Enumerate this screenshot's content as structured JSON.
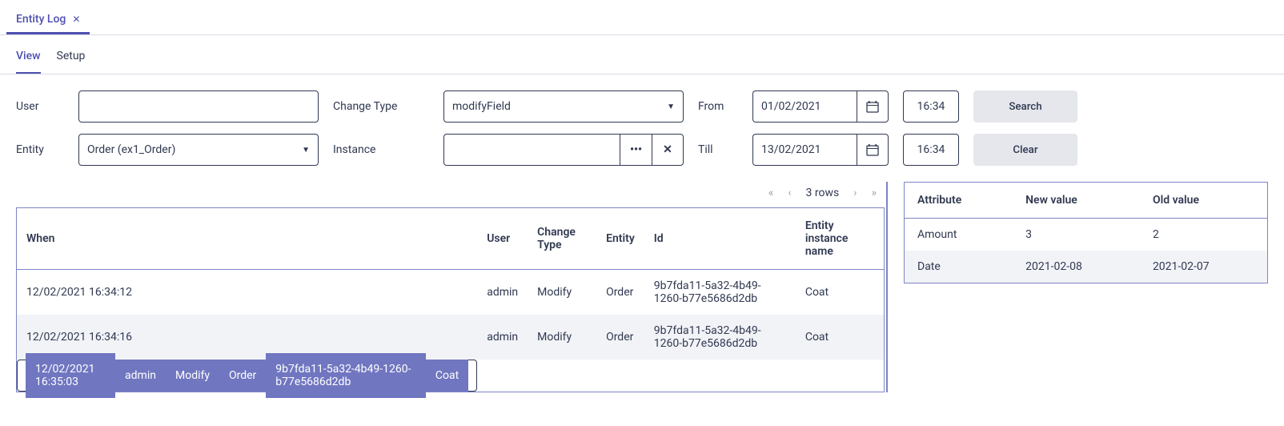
{
  "headerTab": {
    "label": "Entity Log"
  },
  "innerTabs": {
    "view": "View",
    "setup": "Setup"
  },
  "labels": {
    "user": "User",
    "changeType": "Change Type",
    "from": "From",
    "entity": "Entity",
    "instance": "Instance",
    "till": "Till"
  },
  "fields": {
    "user": "",
    "changeType": "modifyField",
    "entity": "Order (ex1_Order)",
    "instance": "",
    "fromDate": "01/02/2021",
    "fromTime": "16:34",
    "tillDate": "13/02/2021",
    "tillTime": "16:34"
  },
  "buttons": {
    "search": "Search",
    "clear": "Clear"
  },
  "pager": {
    "rowsText": "3 rows"
  },
  "logTable": {
    "headers": {
      "when": "When",
      "user": "User",
      "changeType": "Change Type",
      "entity": "Entity",
      "id": "Id",
      "instanceName": "Entity instance name"
    },
    "rows": [
      {
        "when": "12/02/2021 16:34:12",
        "user": "admin",
        "changeType": "Modify",
        "entity": "Order",
        "id": "9b7fda11-5a32-4b49-1260-b77e5686d2db",
        "instanceName": "Coat"
      },
      {
        "when": "12/02/2021 16:34:16",
        "user": "admin",
        "changeType": "Modify",
        "entity": "Order",
        "id": "9b7fda11-5a32-4b49-1260-b77e5686d2db",
        "instanceName": "Coat"
      },
      {
        "when": "12/02/2021 16:35:03",
        "user": "admin",
        "changeType": "Modify",
        "entity": "Order",
        "id": "9b7fda11-5a32-4b49-1260-b77e5686d2db",
        "instanceName": "Coat"
      }
    ]
  },
  "attrTable": {
    "headers": {
      "attribute": "Attribute",
      "newValue": "New value",
      "oldValue": "Old value"
    },
    "rows": [
      {
        "attribute": "Amount",
        "newValue": "3",
        "oldValue": "2"
      },
      {
        "attribute": "Date",
        "newValue": "2021-02-08",
        "oldValue": "2021-02-07"
      }
    ]
  }
}
